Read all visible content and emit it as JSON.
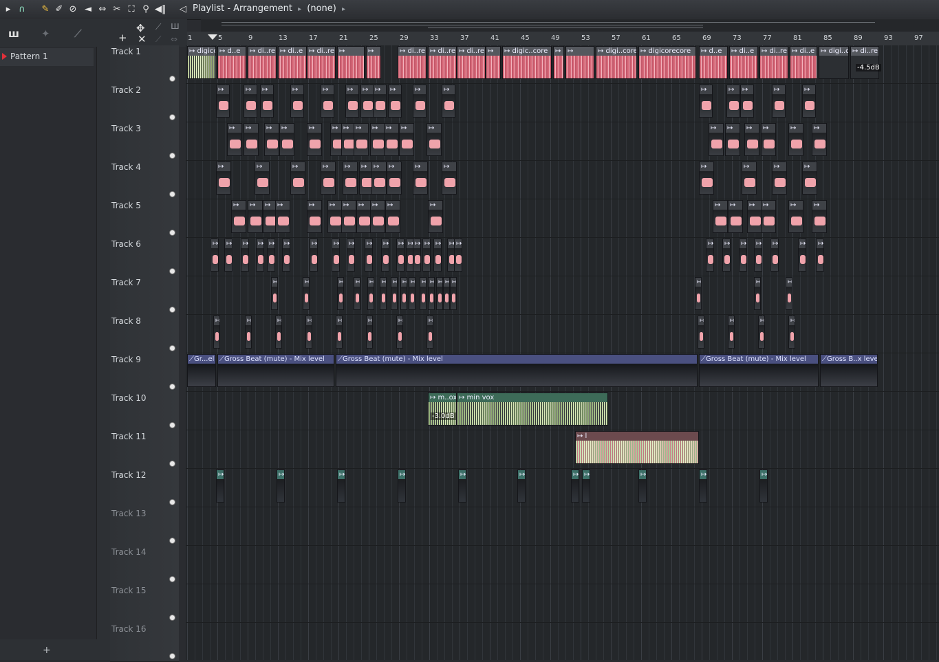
{
  "window": {
    "title": "Playlist - Arrangement",
    "arrangement": "(none)"
  },
  "toolbar": {
    "icons": [
      "play-icon",
      "magnet-icon",
      "pencil-icon",
      "paint-icon",
      "delete-icon",
      "mute-icon",
      "slip-icon",
      "slice-icon",
      "select-icon",
      "zoom-icon",
      "playback-icon",
      "speaker-icon"
    ]
  },
  "left_panel": {
    "patterns": [
      {
        "label": "Pattern 1"
      }
    ],
    "add_label": "+"
  },
  "ruler": {
    "bars": [
      "1",
      "5",
      "9",
      "13",
      "17",
      "21",
      "25",
      "29",
      "33",
      "37",
      "41",
      "45",
      "49",
      "53",
      "57",
      "61",
      "65",
      "69",
      "73",
      "77",
      "81",
      "85",
      "89",
      "93",
      "97"
    ]
  },
  "tracks": [
    {
      "name": "Track 1"
    },
    {
      "name": "Track 2"
    },
    {
      "name": "Track 3"
    },
    {
      "name": "Track 4"
    },
    {
      "name": "Track 5"
    },
    {
      "name": "Track 6"
    },
    {
      "name": "Track 7"
    },
    {
      "name": "Track 8"
    },
    {
      "name": "Track 9"
    },
    {
      "name": "Track 10"
    },
    {
      "name": "Track 11"
    },
    {
      "name": "Track 12"
    },
    {
      "name": "Track 13"
    },
    {
      "name": "Track 14"
    },
    {
      "name": "Track 15"
    },
    {
      "name": "Track 16"
    }
  ],
  "clips_track1": [
    {
      "label": "digicorecore"
    },
    {
      "label": "d..e"
    },
    {
      "label": "di..re"
    },
    {
      "label": "di..e"
    },
    {
      "label": "di..re"
    },
    {
      "label": ""
    },
    {
      "label": ""
    },
    {
      "label": "di..re"
    },
    {
      "label": "di..re"
    },
    {
      "label": "di..re"
    },
    {
      "label": ""
    },
    {
      "label": "digic..core"
    },
    {
      "label": ""
    },
    {
      "label": ""
    },
    {
      "label": "digi..core"
    },
    {
      "label": "digicorecore"
    },
    {
      "label": "d..e"
    },
    {
      "label": "di..e"
    },
    {
      "label": "di..re"
    },
    {
      "label": "di..e"
    },
    {
      "label": "digi..o"
    },
    {
      "label": "di..re"
    }
  ],
  "track1_gain": "-4.5dB",
  "clips_track9": [
    {
      "label": "Gr...el"
    },
    {
      "label": "Gross Beat (mute) - Mix level"
    },
    {
      "label": "Gross Beat (mute) - Mix level"
    },
    {
      "label": "Gross Beat (mute) - Mix level"
    },
    {
      "label": "Gross B..x level"
    }
  ],
  "clips_track10": [
    {
      "label": "m..ox"
    },
    {
      "label": "min vox"
    }
  ],
  "track10_gain": "-3.0dB",
  "clips_track11": [
    {
      "label": "l"
    }
  ],
  "colors": {
    "audio_red": "#d86a7a",
    "automation": "#4a5080",
    "vox_green": "#3d6b58",
    "playhead_red": "#e2303a"
  }
}
